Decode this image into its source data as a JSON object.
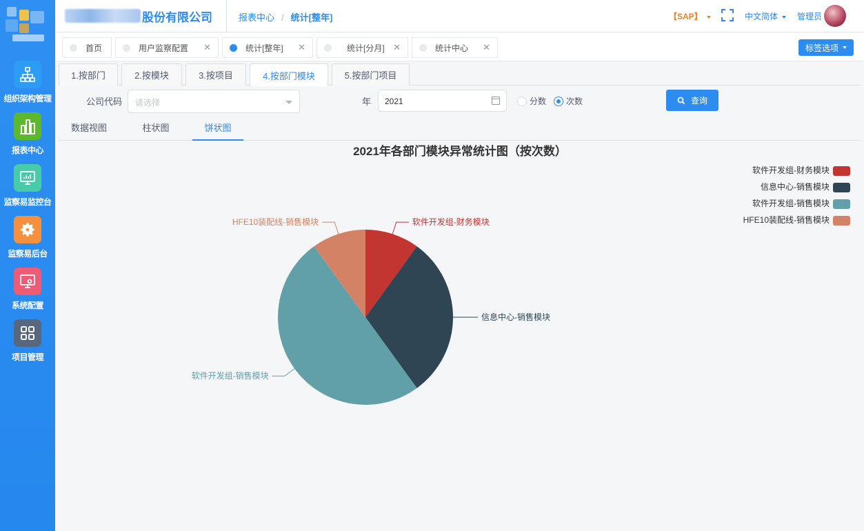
{
  "header": {
    "company_suffix": "股份有限公司",
    "breadcrumb": [
      "报表中心",
      "统计[整年]"
    ],
    "sap_label": "【SAP】",
    "language": "中文简体",
    "user": "管理员"
  },
  "sidebar": {
    "items": [
      {
        "label": "组织架构管理",
        "icon": "org-chart-icon",
        "color": "#2d9cf5"
      },
      {
        "label": "报表中心",
        "icon": "bar-chart-icon",
        "color": "#5cb82c"
      },
      {
        "label": "监察易监控台",
        "icon": "monitor-icon",
        "color": "#47cba8"
      },
      {
        "label": "监察易后台",
        "icon": "gear-icon",
        "color": "#f5913e"
      },
      {
        "label": "系统配置",
        "icon": "settings-screen-icon",
        "color": "#ee5b74"
      },
      {
        "label": "项目管理",
        "icon": "grid-icon",
        "color": "#56677e"
      }
    ]
  },
  "page_tabs": [
    {
      "label": "首页",
      "active": false,
      "closable": false
    },
    {
      "label": "用户监察配置",
      "active": false,
      "closable": true
    },
    {
      "label": "统计[整年]",
      "active": true,
      "closable": true
    },
    {
      "label": "统计[分月]",
      "active": false,
      "closable": true
    },
    {
      "label": "统计中心",
      "active": false,
      "closable": true
    }
  ],
  "tag_options_label": "标签选项",
  "sub_tabs": [
    "1.按部门",
    "2.按模块",
    "3.按项目",
    "4.按部门模块",
    "5.按部门项目"
  ],
  "active_sub_tab": 3,
  "filters": {
    "company_label": "公司代码",
    "company_placeholder": "请选择",
    "year_label": "年",
    "year_value": "2021",
    "radio_score": "分数",
    "radio_count": "次数",
    "selected": "次数",
    "query_label": "查询"
  },
  "view_tabs": [
    "数据视图",
    "柱状图",
    "饼状图"
  ],
  "active_view_tab": 2,
  "colors": {
    "primary": "#2d8cf0"
  },
  "chart_data": {
    "type": "pie",
    "title": "2021年各部门模块异常统计图（按次数）",
    "legend_position": "top-right",
    "slices": [
      {
        "label": "软件开发组-财务模块",
        "value": 1,
        "color": "#c23531"
      },
      {
        "label": "信息中心-销售模块",
        "value": 3,
        "color": "#2f4554"
      },
      {
        "label": "软件开发组-销售模块",
        "value": 5,
        "color": "#61a0a8"
      },
      {
        "label": "HFE10装配线-销售模块",
        "value": 1,
        "color": "#d48265"
      }
    ]
  }
}
